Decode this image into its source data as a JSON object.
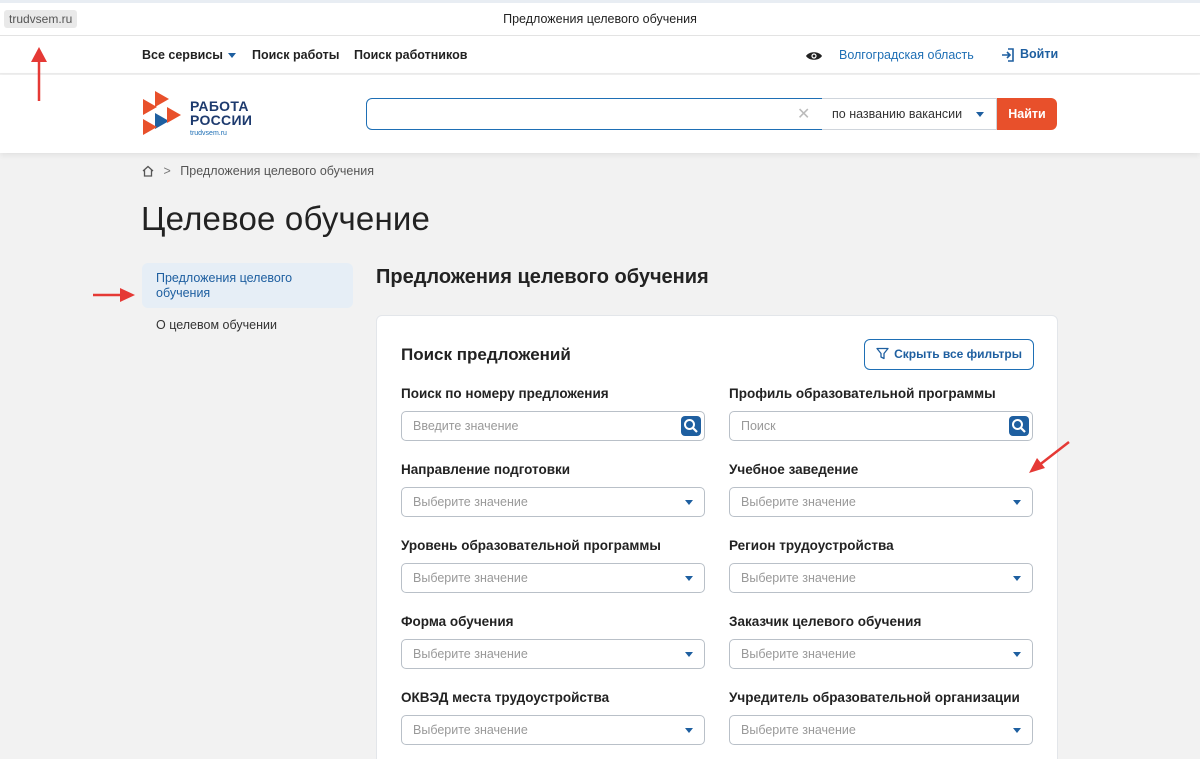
{
  "browser": {
    "url": "trudvsem.ru",
    "tab_title": "Предложения целевого обучения"
  },
  "topnav": {
    "all_services": "Все сервисы",
    "job_search": "Поиск работы",
    "worker_search": "Поиск работников",
    "region": "Волгоградская область",
    "login": "Войти"
  },
  "header": {
    "logo_line1": "РАБОТА",
    "logo_line2": "РОССИИ",
    "logo_line3": "trudvsem.ru",
    "search_value": "",
    "search_type": "по названию вакансии",
    "find_button": "Найти"
  },
  "breadcrumb": {
    "current": "Предложения целевого обучения",
    "separator": ">"
  },
  "page_title": "Целевое обучение",
  "sidebar": {
    "items": [
      {
        "label": "Предложения целевого обучения",
        "active": true
      },
      {
        "label": "О целевом обучении",
        "active": false
      }
    ]
  },
  "section_title": "Предложения целевого обучения",
  "search_card": {
    "title": "Поиск предложений",
    "hide_filters": "Скрыть все фильтры",
    "fields": [
      {
        "label": "Поиск по номеру предложения",
        "placeholder": "Введите значение",
        "kind": "text"
      },
      {
        "label": "Профиль образовательной программы",
        "placeholder": "Поиск",
        "kind": "text"
      },
      {
        "label": "Направление подготовки",
        "placeholder": "Выберите значение",
        "kind": "select"
      },
      {
        "label": "Учебное заведение",
        "placeholder": "Выберите значение",
        "kind": "select"
      },
      {
        "label": "Уровень образовательной программы",
        "placeholder": "Выберите значение",
        "kind": "select"
      },
      {
        "label": "Регион трудоустройства",
        "placeholder": "Выберите значение",
        "kind": "select"
      },
      {
        "label": "Форма обучения",
        "placeholder": "Выберите значение",
        "kind": "select"
      },
      {
        "label": "Заказчик целевого обучения",
        "placeholder": "Выберите значение",
        "kind": "select"
      },
      {
        "label": "ОКВЭД места трудоустройства",
        "placeholder": "Выберите значение",
        "kind": "select"
      },
      {
        "label": "Учредитель образовательной организации",
        "placeholder": "Выберите значение",
        "kind": "select"
      }
    ]
  },
  "colors": {
    "brand_blue": "#1e5fa0",
    "accent_red": "#e8502b",
    "annotation_red": "#e53935"
  }
}
